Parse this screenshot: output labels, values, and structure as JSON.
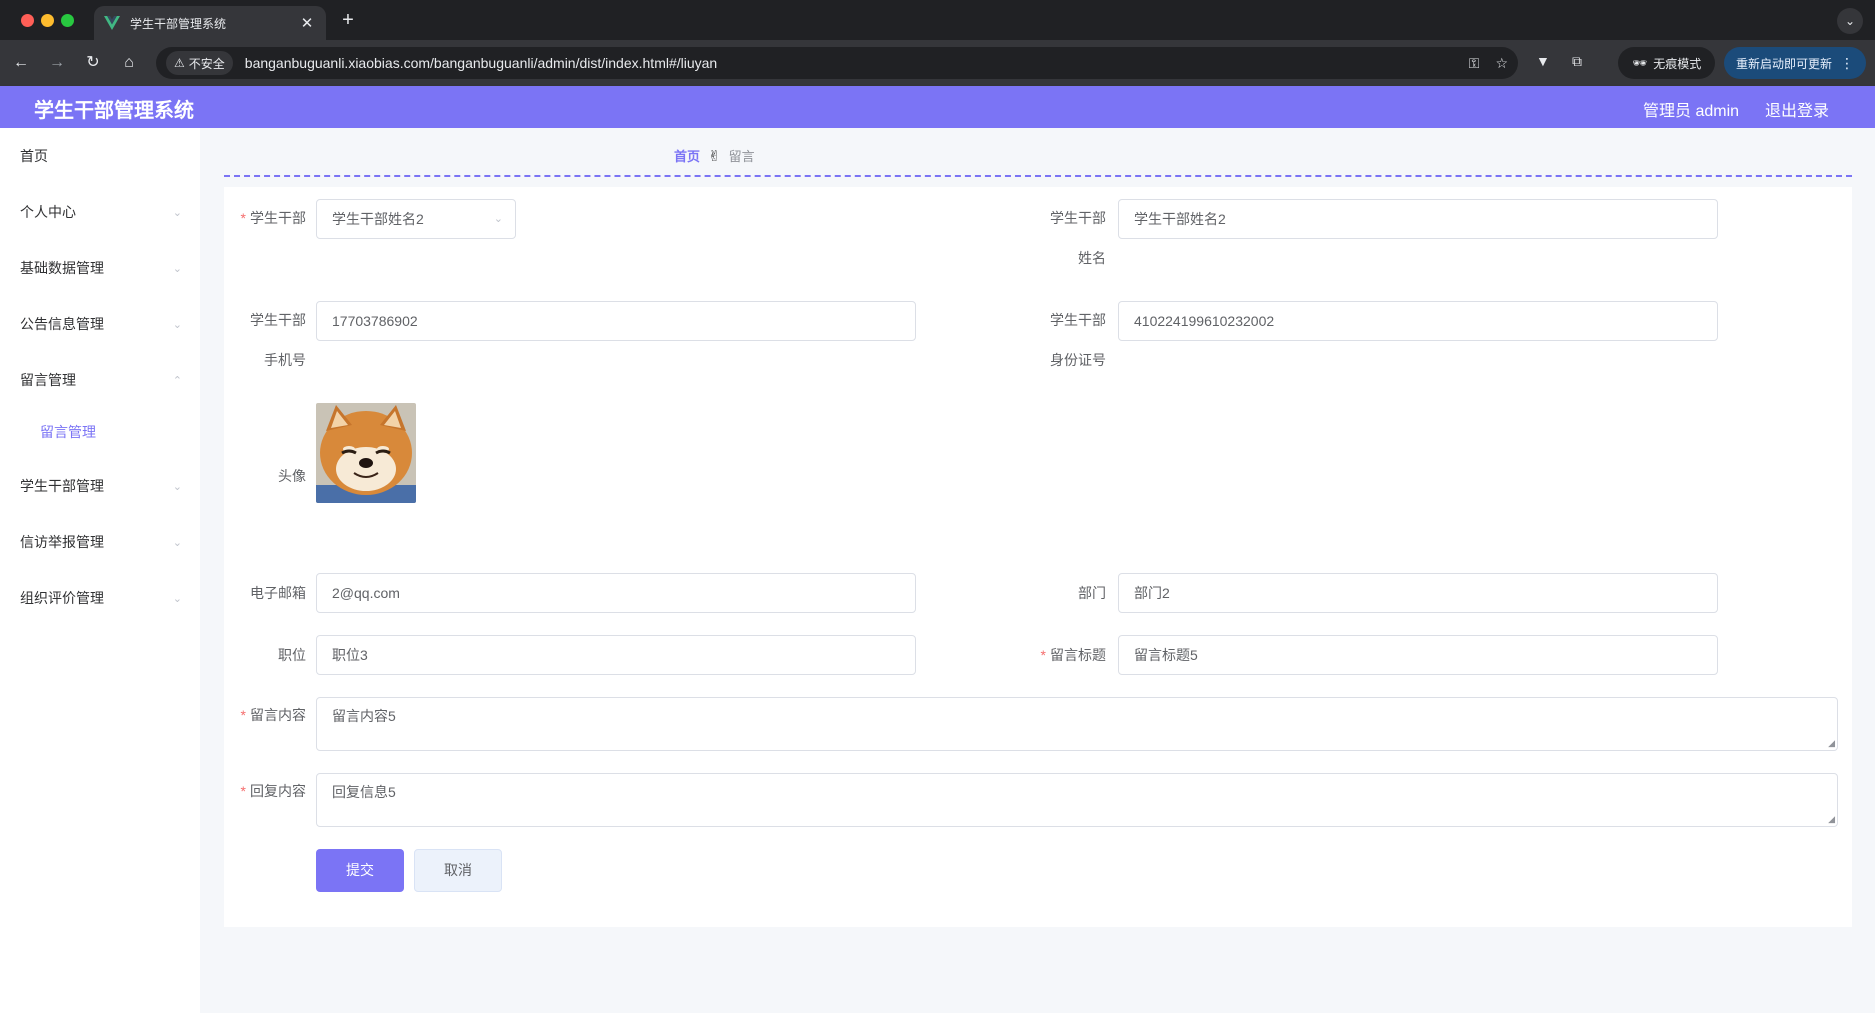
{
  "browser": {
    "tab_title": "学生干部管理系统",
    "tab_close": "✕",
    "new_tab": "+",
    "security_label": "不安全",
    "url": "banganbuguanli.xiaobias.com/banganbuguanli/admin/dist/index.html#/liuyan",
    "incognito_label": "无痕模式",
    "update_label": "重新启动即可更新"
  },
  "header": {
    "title": "学生干部管理系统",
    "admin_label": "管理员 admin",
    "logout_label": "退出登录"
  },
  "sidebar": {
    "items": [
      {
        "label": "首页"
      },
      {
        "label": "个人中心"
      },
      {
        "label": "基础数据管理"
      },
      {
        "label": "公告信息管理"
      },
      {
        "label": "留言管理"
      },
      {
        "label": "学生干部管理"
      },
      {
        "label": "信访举报管理"
      },
      {
        "label": "组织评价管理"
      }
    ],
    "subitem": {
      "label": "留言管理"
    }
  },
  "breadcrumb": {
    "home": "首页",
    "separator": "✌",
    "current": "留言"
  },
  "form": {
    "cadre_select": {
      "label": "学生干部",
      "value": "学生干部姓名2"
    },
    "cadre_name": {
      "label_line1": "学生干部",
      "label_line2": "姓名",
      "value": "学生干部姓名2"
    },
    "phone": {
      "label_line1": "学生干部",
      "label_line2": "手机号",
      "value": "17703786902"
    },
    "id_card": {
      "label_line1": "学生干部",
      "label_line2": "身份证号",
      "value": "410224199610232002"
    },
    "avatar": {
      "label": "头像"
    },
    "email": {
      "label": "电子邮箱",
      "value": "2@qq.com"
    },
    "department": {
      "label": "部门",
      "value": "部门2"
    },
    "position": {
      "label": "职位",
      "value": "职位3"
    },
    "message_title": {
      "label": "留言标题",
      "value": "留言标题5"
    },
    "message_content": {
      "label": "留言内容",
      "value": "留言内容5"
    },
    "reply_content": {
      "label": "回复内容",
      "value": "回复信息5"
    },
    "submit_label": "提交",
    "cancel_label": "取消"
  },
  "colors": {
    "accent": "#7b74f5",
    "required": "#f56c6c"
  }
}
